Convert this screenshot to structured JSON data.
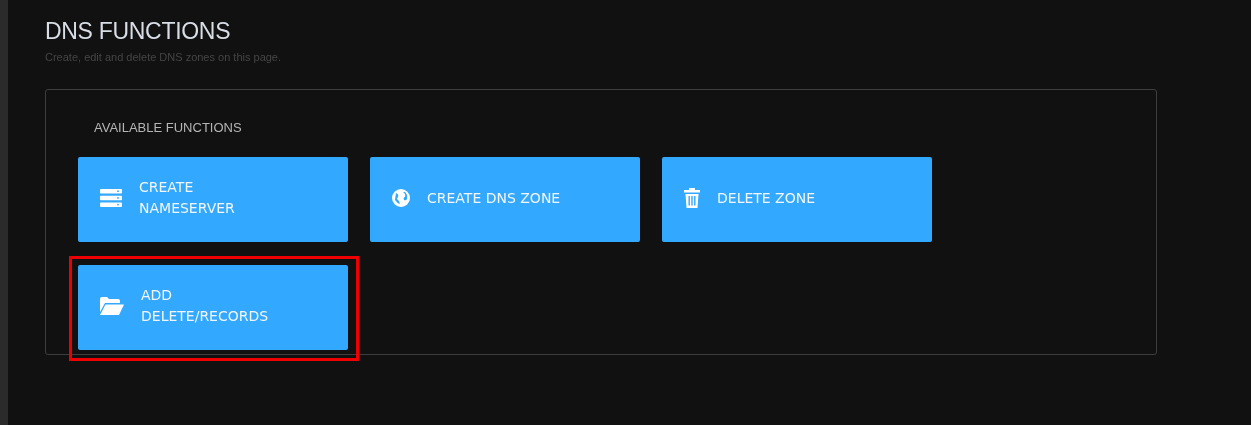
{
  "page": {
    "title": "DNS FUNCTIONS",
    "subtitle": "Create, edit and delete DNS zones on this page."
  },
  "panel": {
    "heading": "AVAILABLE FUNCTIONS",
    "buttons": [
      {
        "kind": "server",
        "lines": [
          "CREATE",
          "NAMESERVER"
        ],
        "highlighted": false
      },
      {
        "kind": "globe",
        "lines": [
          "CREATE DNS ZONE"
        ],
        "highlighted": false
      },
      {
        "kind": "trash",
        "lines": [
          "DELETE ZONE"
        ],
        "highlighted": false
      },
      {
        "kind": "folder",
        "lines": [
          "ADD",
          "DELETE/RECORDS"
        ],
        "highlighted": true
      }
    ]
  }
}
